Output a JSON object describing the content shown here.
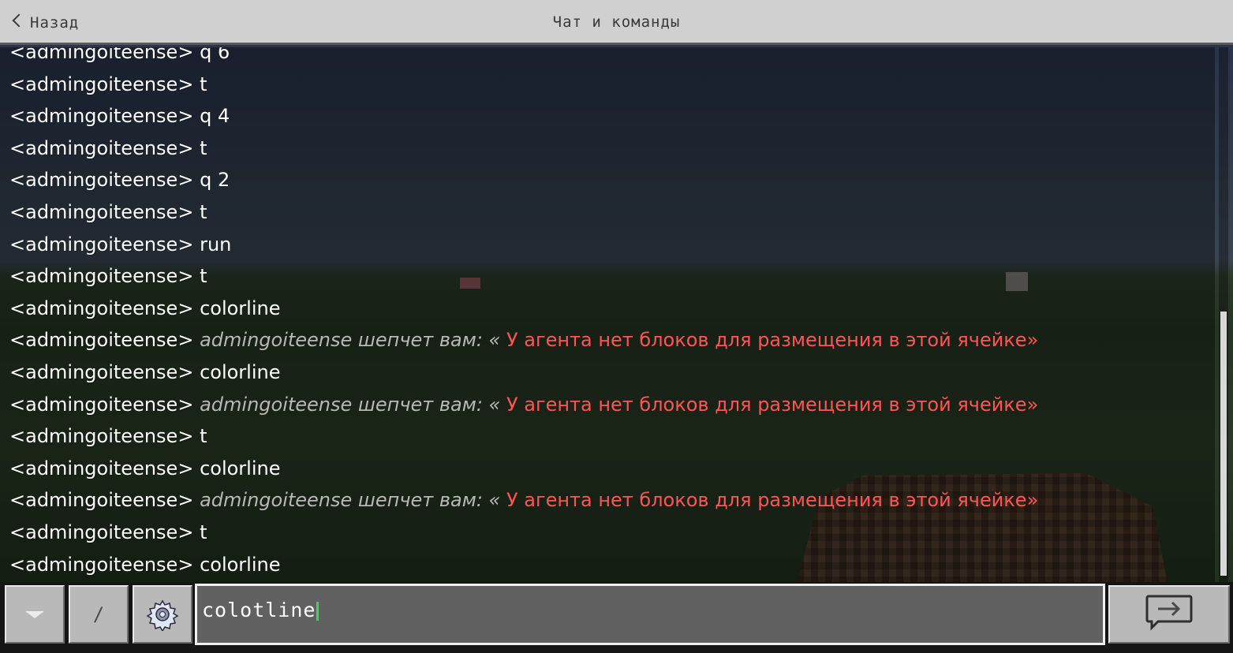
{
  "header": {
    "back_label": "Назад",
    "title": "Чат и команды"
  },
  "chat": {
    "lines": [
      {
        "sender": "<admingoiteense>",
        "text": "q 6",
        "whisper": "",
        "alert": ""
      },
      {
        "sender": "<admingoiteense>",
        "text": "t",
        "whisper": "",
        "alert": ""
      },
      {
        "sender": "<admingoiteense>",
        "text": "q 4",
        "whisper": "",
        "alert": ""
      },
      {
        "sender": "<admingoiteense>",
        "text": "t",
        "whisper": "",
        "alert": ""
      },
      {
        "sender": "<admingoiteense>",
        "text": "q 2",
        "whisper": "",
        "alert": ""
      },
      {
        "sender": "<admingoiteense>",
        "text": "t",
        "whisper": "",
        "alert": ""
      },
      {
        "sender": "<admingoiteense>",
        "text": "run",
        "whisper": "",
        "alert": ""
      },
      {
        "sender": "<admingoiteense>",
        "text": "t",
        "whisper": "",
        "alert": ""
      },
      {
        "sender": "<admingoiteense>",
        "text": "colorline",
        "whisper": "",
        "alert": ""
      },
      {
        "sender": "<admingoiteense>",
        "text": "",
        "whisper": "admingoiteense шепчет вам: «",
        "alert": " У агента нет блоков для размещения в этой ячейке»"
      },
      {
        "sender": "<admingoiteense>",
        "text": "colorline",
        "whisper": "",
        "alert": ""
      },
      {
        "sender": "<admingoiteense>",
        "text": "",
        "whisper": "admingoiteense шепчет вам: «",
        "alert": " У агента нет блоков для размещения в этой ячейке»"
      },
      {
        "sender": "<admingoiteense>",
        "text": "t",
        "whisper": "",
        "alert": ""
      },
      {
        "sender": "<admingoiteense>",
        "text": "colorline",
        "whisper": "",
        "alert": ""
      },
      {
        "sender": "<admingoiteense>",
        "text": "",
        "whisper": "admingoiteense шепчет вам: «",
        "alert": " У агента нет блоков для размещения в этой ячейке»"
      },
      {
        "sender": "<admingoiteense>",
        "text": "t",
        "whisper": "",
        "alert": ""
      },
      {
        "sender": "<admingoiteense>",
        "text": "colorline",
        "whisper": "",
        "alert": ""
      }
    ]
  },
  "input": {
    "value": "colotline"
  },
  "icons": {
    "back": "chevron-left-icon",
    "dropdown": "triangle-down-icon",
    "slash": "slash-icon",
    "settings": "gear-icon",
    "send": "send-arrow-icon"
  },
  "colors": {
    "whisper": "#b8b8b8",
    "alert": "#ff5555",
    "caret": "#39d85a"
  }
}
